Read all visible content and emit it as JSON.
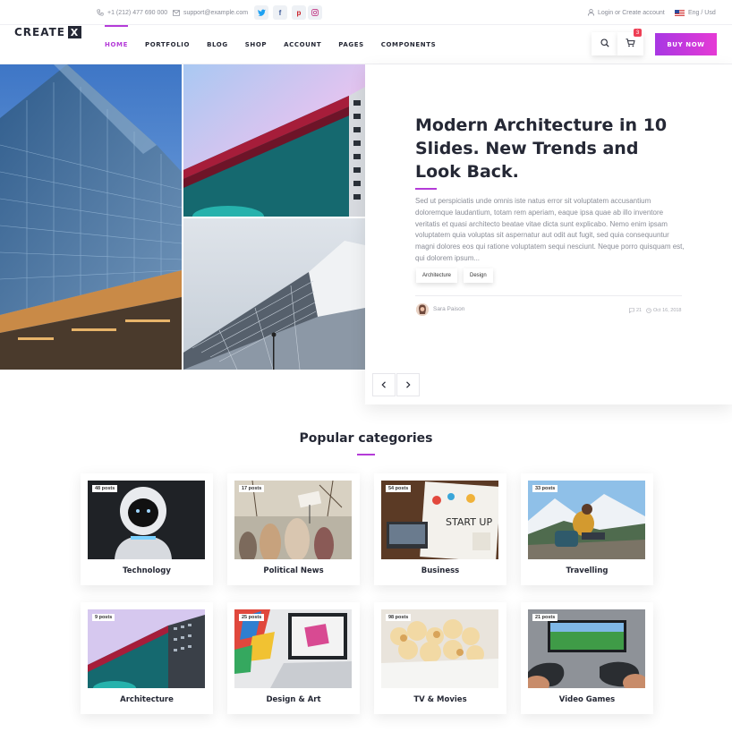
{
  "topbar": {
    "phone": "+1 (212) 477 690 000",
    "email": "support@example.com",
    "login": "Login or Create account",
    "language": "Eng / Usd",
    "socials": [
      "twitter-icon",
      "facebook-icon",
      "pinterest-icon",
      "instagram-icon"
    ]
  },
  "brand": {
    "logo_text": "CREATE",
    "logo_mark": "X"
  },
  "nav": {
    "items": [
      "HOME",
      "PORTFOLIO",
      "BLOG",
      "SHOP",
      "ACCOUNT",
      "PAGES",
      "COMPONENTS"
    ],
    "active": "HOME",
    "cart_count": "3",
    "buy_label": "BUY NOW"
  },
  "hero": {
    "title": "Modern Architecture in 10 Slides. New Trends and Look Back.",
    "excerpt": "Sed ut perspiciatis unde omnis iste natus error sit voluptatem accusantium doloremque laudantium, totam rem aperiam, eaque ipsa quae ab illo inventore veritatis et quasi architecto beatae vitae dicta sunt explicabo. Nemo enim ipsam voluptatem quia voluptas sit aspernatur aut odit aut fugit, sed quia consequuntur magni dolores eos qui ratione voluptatem sequi nesciunt. Neque porro quisquam est, qui dolorem ipsum...",
    "tags": [
      "Architecture",
      "Design"
    ],
    "author": "Sara Paison",
    "comments": "21",
    "date": "Oct 16, 2018"
  },
  "categories": {
    "title": "Popular categories",
    "items": [
      {
        "name": "Technology",
        "posts": "48 posts"
      },
      {
        "name": "Political News",
        "posts": "17 posts"
      },
      {
        "name": "Business",
        "posts": "54 posts"
      },
      {
        "name": "Travelling",
        "posts": "33 posts"
      },
      {
        "name": "Architecture",
        "posts": "9 posts"
      },
      {
        "name": "Design & Art",
        "posts": "25 posts"
      },
      {
        "name": "TV & Movies",
        "posts": "98 posts"
      },
      {
        "name": "Video Games",
        "posts": "21 posts"
      }
    ]
  },
  "colors": {
    "accent": "#b43bd8",
    "dark": "#252835",
    "badge": "#ee3f55"
  }
}
